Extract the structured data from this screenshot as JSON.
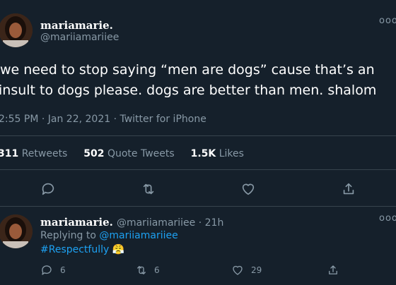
{
  "main_tweet": {
    "display_name": "mariamarie.",
    "handle": "@mariiamariiee",
    "text_line1": "we need to stop saying “men are dogs” cause that’s an",
    "text_line2": "insult to dogs please. dogs are better than men. shalom",
    "meta": "2:55 PM · Jan 22, 2021 · Twitter for iPhone",
    "stats": {
      "retweets_count": "311",
      "retweets_label": "Retweets",
      "quotes_count": "502",
      "quotes_label": "Quote Tweets",
      "likes_count": "1.5K",
      "likes_label": "Likes"
    },
    "more_icon": "ooo"
  },
  "reply_tweet": {
    "display_name": "mariamarie.",
    "handle_time": "@mariiamariiee · 21h",
    "replying_to_label": "Replying to",
    "replying_to_handle": "@mariiamariiee",
    "hashtag": "#Respectfully",
    "emoji": "😤",
    "more_icon": "ooo",
    "counts": {
      "replies": "6",
      "retweets": "6",
      "likes": "29"
    }
  },
  "icons": [
    "reply-icon",
    "retweet-icon",
    "like-icon",
    "share-icon",
    "more-icon"
  ],
  "colors": {
    "background": "#15202b",
    "muted": "#8899a6",
    "accent": "#1da1f2",
    "divider": "#38444d"
  }
}
